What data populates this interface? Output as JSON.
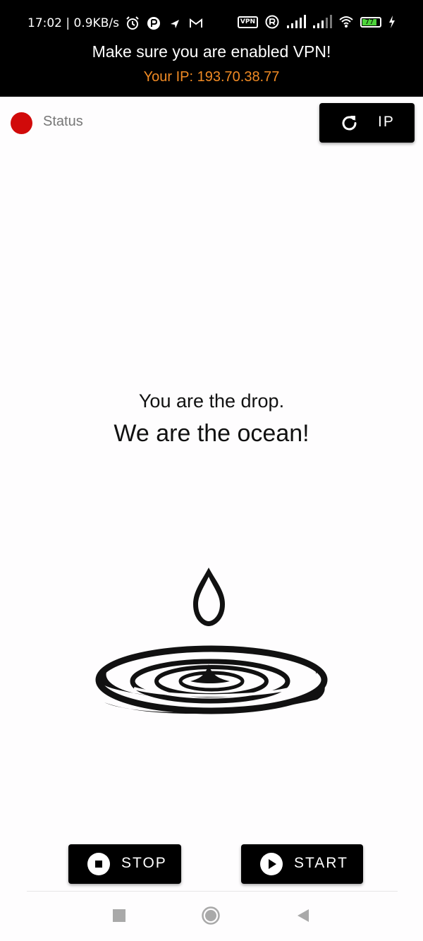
{
  "status_bar": {
    "time_speed": "17:02 | 0.9KB/s",
    "vpn_badge": "VPN",
    "battery_level": "77",
    "colors": {
      "battery_fill": "#4cd23a"
    },
    "icons": [
      "alarm-icon",
      "app-notification-icon",
      "location-icon",
      "gmail-icon",
      "vpn-icon",
      "registered-icon",
      "signal-icon",
      "signal-icon",
      "wifi-icon",
      "battery-icon",
      "charging-icon"
    ]
  },
  "banner": {
    "title": "Make sure you are enabled VPN!",
    "ip_text": "Your IP: 193.70.38.77",
    "colors": {
      "ip_text": "#f08a24",
      "background": "#000000"
    }
  },
  "status": {
    "label": "Status",
    "colors": {
      "indicator": "#d10a0a"
    }
  },
  "ip_button": {
    "label": "IP",
    "icon": "refresh-icon"
  },
  "slogan": {
    "line1": "You are the drop.",
    "line2": "We are the ocean!"
  },
  "illustration": {
    "icon": "water-drop-ripple-icon"
  },
  "actions": {
    "stop_label": "STOP",
    "start_label": "START",
    "stop_icon": "stop-icon",
    "start_icon": "play-icon"
  },
  "nav_bar": {
    "icons": [
      "recents-icon",
      "home-icon",
      "back-icon"
    ]
  }
}
